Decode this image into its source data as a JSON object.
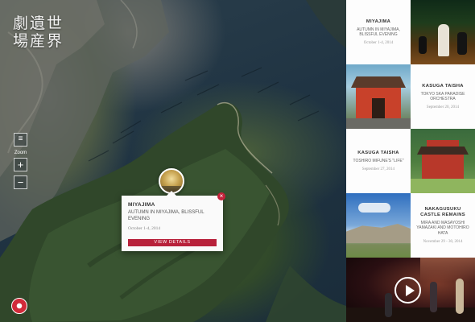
{
  "logo": {
    "row1": "劇遺世",
    "row2": "場産界"
  },
  "map_controls": {
    "menu_icon": "≡",
    "zoom_label": "Zoom",
    "zoom_in": "+",
    "zoom_out": "−"
  },
  "popup": {
    "title": "MIYAJIMA",
    "subtitle": "AUTUMN IN MIYAJIMA, BLISSFUL EVENING",
    "date": "October 1-4, 2014",
    "button": "VIEW DETAILS",
    "close": "×"
  },
  "brand": {
    "text": ""
  },
  "events": [
    {
      "title": "MIYAJIMA",
      "subtitle": "AUTUMN IN MIYAJIMA, BLISSFUL EVENING",
      "date": "October 1-4, 2014"
    },
    {
      "title": "KASUGA TAISHA",
      "subtitle": "TOKYO SKA PARADISE ORCHESTRA",
      "date": "September 20, 2014"
    },
    {
      "title": "KASUGA TAISHA",
      "subtitle": "TOSHIRO MIFUNE'S \"LIFE\"",
      "date": "September 27, 2014"
    },
    {
      "title": "NAKAGUSUKU CASTLE REMAINS",
      "subtitle": "MIRA AND MASAYOSHI YAMAZAKI AND MOTOHIRO HATA",
      "date": "November 29 - 30, 2014"
    }
  ],
  "colors": {
    "accent": "#c5213a",
    "panel": "#ececec",
    "map": "#203443"
  }
}
